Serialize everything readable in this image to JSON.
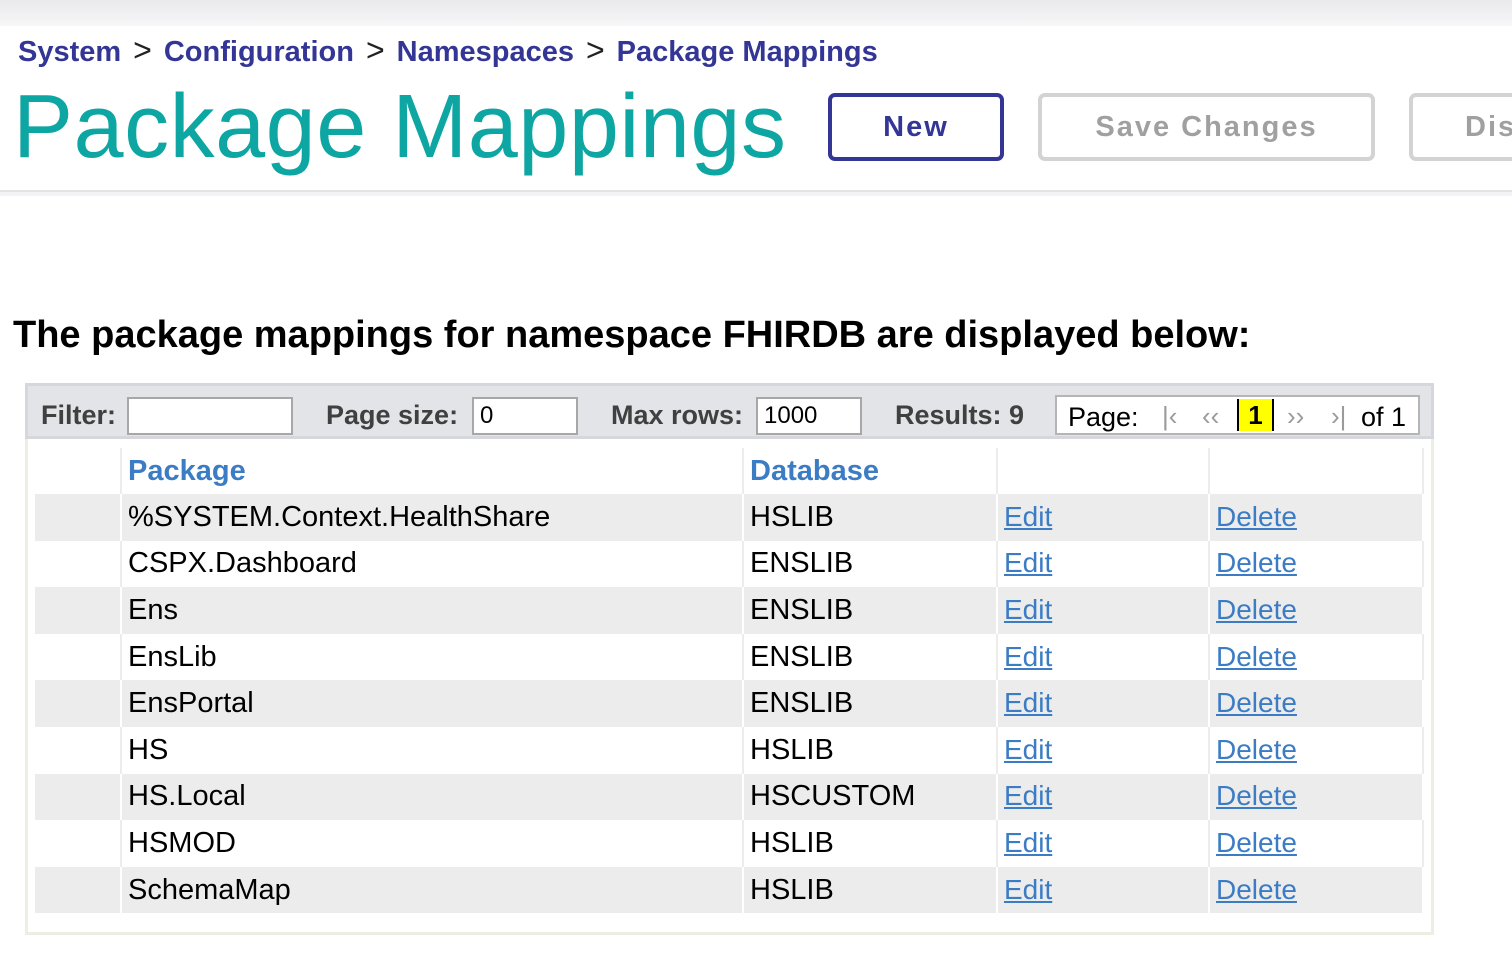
{
  "breadcrumb": [
    {
      "label": "System"
    },
    {
      "label": "Configuration"
    },
    {
      "label": "Namespaces"
    },
    {
      "label": "Package Mappings"
    }
  ],
  "breadcrumb_separator": ">",
  "page_title": "Package Mappings",
  "buttons": {
    "new": "New",
    "save": "Save Changes",
    "discard": "Dis"
  },
  "section_title": "The package mappings for namespace FHIRDB are displayed below:",
  "filterbar": {
    "filter_label": "Filter:",
    "filter_value": "",
    "page_size_label": "Page size:",
    "page_size_value": "0",
    "max_rows_label": "Max rows:",
    "max_rows_value": "1000",
    "results_label": "Results: 9",
    "pager": {
      "label": "Page:",
      "first": "|‹",
      "prev": "‹‹",
      "current": "1",
      "next": "››",
      "last": "›|",
      "of": "of 1"
    }
  },
  "table": {
    "columns": [
      "",
      "Package",
      "Database",
      "",
      ""
    ],
    "rows": [
      {
        "package": "%SYSTEM.Context.HealthShare",
        "database": "HSLIB",
        "edit": "Edit",
        "delete": "Delete"
      },
      {
        "package": "CSPX.Dashboard",
        "database": "ENSLIB",
        "edit": "Edit",
        "delete": "Delete"
      },
      {
        "package": "Ens",
        "database": "ENSLIB",
        "edit": "Edit",
        "delete": "Delete"
      },
      {
        "package": "EnsLib",
        "database": "ENSLIB",
        "edit": "Edit",
        "delete": "Delete"
      },
      {
        "package": "EnsPortal",
        "database": "ENSLIB",
        "edit": "Edit",
        "delete": "Delete"
      },
      {
        "package": "HS",
        "database": "HSLIB",
        "edit": "Edit",
        "delete": "Delete"
      },
      {
        "package": "HS.Local",
        "database": "HSCUSTOM",
        "edit": "Edit",
        "delete": "Delete"
      },
      {
        "package": "HSMOD",
        "database": "HSLIB",
        "edit": "Edit",
        "delete": "Delete"
      },
      {
        "package": "SchemaMap",
        "database": "HSLIB",
        "edit": "Edit",
        "delete": "Delete"
      }
    ]
  }
}
